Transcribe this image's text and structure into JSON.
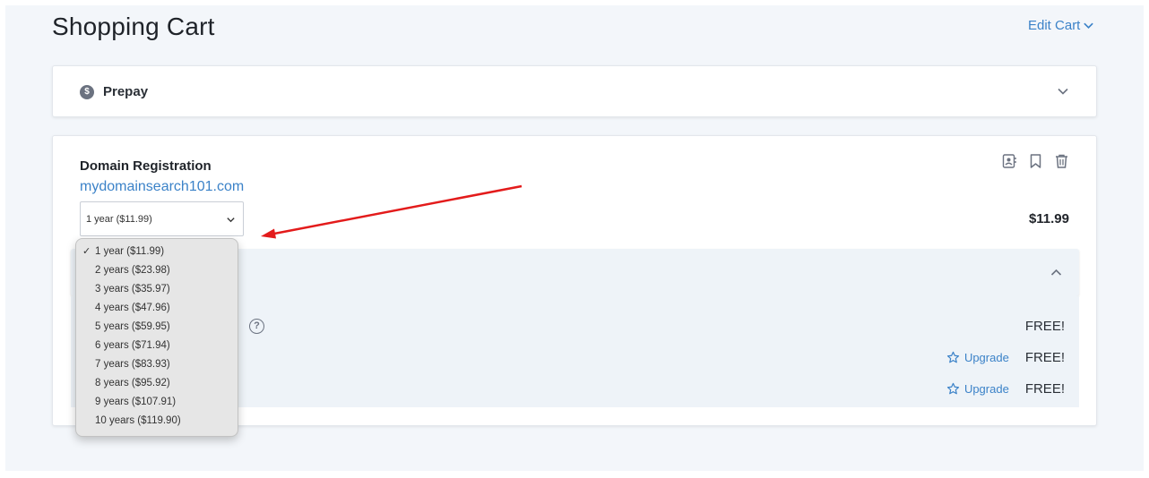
{
  "header": {
    "title": "Shopping Cart",
    "edit_cart_label": "Edit Cart"
  },
  "prepay": {
    "label": "Prepay",
    "icon_glyph": "$"
  },
  "domain": {
    "title": "Domain Registration",
    "name": "mydomainsearch101.com",
    "selected_term": "1 year ($11.99)",
    "price": "$11.99",
    "icons": [
      "contact-card-icon",
      "bookmark-icon",
      "trash-icon"
    ]
  },
  "term_options": [
    "1 year ($11.99)",
    "2 years ($23.98)",
    "3 years ($35.97)",
    "4 years ($47.96)",
    "5 years ($59.95)",
    "6 years ($71.94)",
    "7 years ($83.93)",
    "8 years ($95.92)",
    "9 years ($107.91)",
    "10 years ($119.90)"
  ],
  "addons": [
    {
      "price": "FREE!",
      "upgrade": ""
    },
    {
      "price": "FREE!",
      "upgrade": "Upgrade"
    },
    {
      "price": "FREE!",
      "upgrade": "Upgrade"
    }
  ],
  "help_glyph": "?",
  "check_glyph": "✓",
  "colors": {
    "accent": "#3b82c8",
    "arrow": "#e31b1b",
    "page_background": "#f3f6fa"
  }
}
